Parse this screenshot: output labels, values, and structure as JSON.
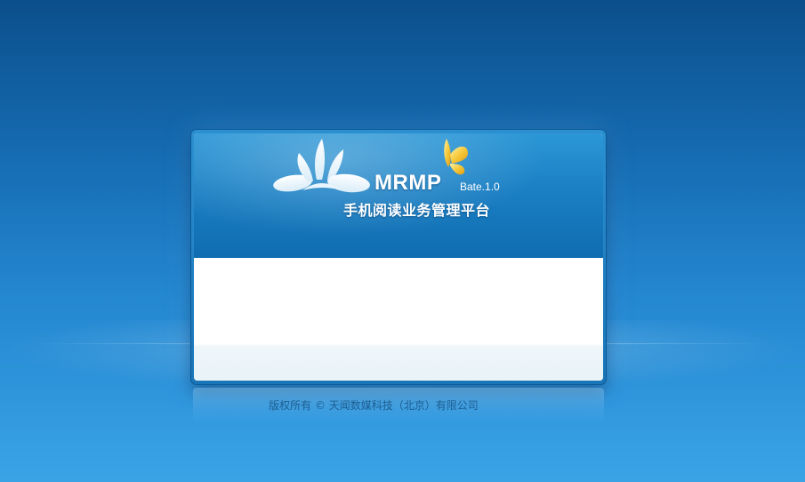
{
  "branding": {
    "name": "MRMP",
    "version": "Bate.1.0",
    "title": "手机阅读业务管理平台",
    "logo_icon": "splash-drops-icon",
    "mascot_icon": "butterfly-icon"
  },
  "footer": {
    "copyright": "版权所有 © 天闻数媒科技（北京）有限公司"
  },
  "colors": {
    "background_top": "#0b4f8b",
    "background_bottom": "#3aa3e6",
    "header_blue": "#1b80c4",
    "butterfly_yellow": "#f2c12e",
    "copyright_text": "#1c5e92"
  }
}
